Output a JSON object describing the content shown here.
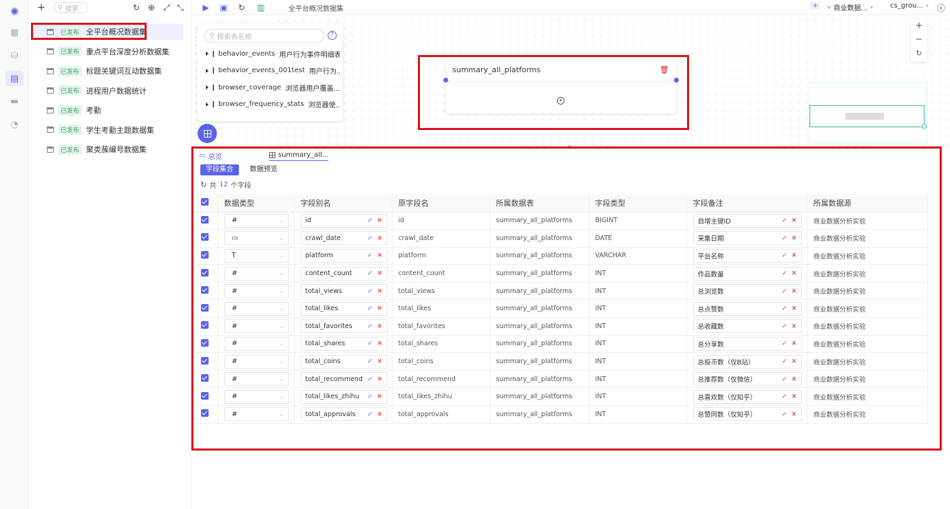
{
  "rail": {
    "icons": [
      "logo-icon",
      "grid-icon",
      "database-icon",
      "dataset-icon",
      "folder-icon",
      "clock-icon"
    ]
  },
  "panel": {
    "search_placeholder": "搜索",
    "status_label": "已发布",
    "datasets": [
      {
        "name": "全平台概况数据集"
      },
      {
        "name": "重点平台深度分析数据集"
      },
      {
        "name": "标题关键词互动数据集"
      },
      {
        "name": "进程用户数据统计"
      },
      {
        "name": "考勤"
      },
      {
        "name": "学生考勤主题数据集"
      },
      {
        "name": "聚类蔟编号数据集"
      }
    ]
  },
  "toolbar": {
    "title": "全平台概况数据集",
    "datasource": "商业数据...",
    "group": "cs_grou..."
  },
  "chooser": {
    "placeholder": "搜索表名称",
    "tables": [
      {
        "name": "behavior_events",
        "desc": "用户行为事件明细表"
      },
      {
        "name": "behavior_events_001test",
        "desc": "用户行为..."
      },
      {
        "name": "browser_coverage",
        "desc": "浏览器用户覆盖..."
      },
      {
        "name": "browser_frequency_stats",
        "desc": "浏览器使..."
      }
    ]
  },
  "node": {
    "title": "summary_all_platforms"
  },
  "bottom": {
    "tab_overview": "总览",
    "tab_table": "summary_all...",
    "subtab_fields": "字段集合",
    "subtab_preview": "数据预览",
    "field_count_prefix": "共",
    "field_count": "12",
    "field_count_suffix": "个字段",
    "headers": [
      "数据类型",
      "字段别名",
      "原字段名",
      "所属数据表",
      "字段类型",
      "字段备注",
      "所属数据源"
    ],
    "rows": [
      {
        "type_icon": "#",
        "alias": "id",
        "orig": "id",
        "table": "summary_all_platforms",
        "ftype": "BIGINT",
        "remark": "自增主键ID",
        "source": "商业数据分析实验"
      },
      {
        "type_icon": "▭",
        "alias": "crawl_date",
        "orig": "crawl_date",
        "table": "summary_all_platforms",
        "ftype": "DATE",
        "remark": "采集日期",
        "source": "商业数据分析实验"
      },
      {
        "type_icon": "T",
        "alias": "platform",
        "orig": "platform",
        "table": "summary_all_platforms",
        "ftype": "VARCHAR",
        "remark": "平台名称",
        "source": "商业数据分析实验"
      },
      {
        "type_icon": "#",
        "alias": "content_count",
        "orig": "content_count",
        "table": "summary_all_platforms",
        "ftype": "INT",
        "remark": "作品数量",
        "source": "商业数据分析实验"
      },
      {
        "type_icon": "#",
        "alias": "total_views",
        "orig": "total_views",
        "table": "summary_all_platforms",
        "ftype": "INT",
        "remark": "总浏览数",
        "source": "商业数据分析实验"
      },
      {
        "type_icon": "#",
        "alias": "total_likes",
        "orig": "total_likes",
        "table": "summary_all_platforms",
        "ftype": "INT",
        "remark": "总点赞数",
        "source": "商业数据分析实验"
      },
      {
        "type_icon": "#",
        "alias": "total_favorites",
        "orig": "total_favorites",
        "table": "summary_all_platforms",
        "ftype": "INT",
        "remark": "总收藏数",
        "source": "商业数据分析实验"
      },
      {
        "type_icon": "#",
        "alias": "total_shares",
        "orig": "total_shares",
        "table": "summary_all_platforms",
        "ftype": "INT",
        "remark": "总分享数",
        "source": "商业数据分析实验"
      },
      {
        "type_icon": "#",
        "alias": "total_coins",
        "orig": "total_coins",
        "table": "summary_all_platforms",
        "ftype": "INT",
        "remark": "总投币数（仅B站）",
        "source": "商业数据分析实验"
      },
      {
        "type_icon": "#",
        "alias": "total_recommend",
        "orig": "total_recommend",
        "table": "summary_all_platforms",
        "ftype": "INT",
        "remark": "总推荐数（仅微信）",
        "source": "商业数据分析实验"
      },
      {
        "type_icon": "#",
        "alias": "total_likes_zhihu",
        "orig": "total_likes_zhihu",
        "table": "summary_all_platforms",
        "ftype": "INT",
        "remark": "总喜欢数（仅知乎）",
        "source": "商业数据分析实验"
      },
      {
        "type_icon": "#",
        "alias": "total_approvals",
        "orig": "total_approvals",
        "table": "summary_all_platforms",
        "ftype": "INT",
        "remark": "总赞同数（仅知乎）",
        "source": "商业数据分析实验"
      }
    ]
  },
  "colors": {
    "accent": "#5b63e6",
    "highlight": "#d9161b",
    "published": "#3ba26a"
  }
}
